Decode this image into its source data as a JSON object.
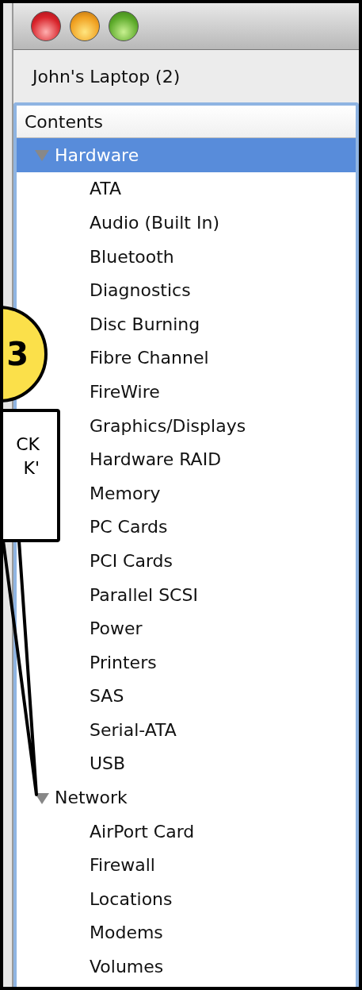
{
  "device": "John's Laptop (2)",
  "outline": {
    "header": "Contents",
    "items": [
      {
        "label": "Hardware",
        "expanded": true,
        "selected": true,
        "children": [
          {
            "label": "ATA",
            "selected": false
          },
          {
            "label": "Audio (Built In)",
            "selected": false
          },
          {
            "label": "Bluetooth",
            "selected": false
          },
          {
            "label": "Diagnostics",
            "selected": false
          },
          {
            "label": "Disc Burning",
            "selected": false
          },
          {
            "label": "Fibre Channel",
            "selected": false
          },
          {
            "label": "FireWire",
            "selected": false
          },
          {
            "label": "Graphics/Displays",
            "selected": false
          },
          {
            "label": "Hardware RAID",
            "selected": false
          },
          {
            "label": "Memory",
            "selected": false
          },
          {
            "label": "PC Cards",
            "selected": false
          },
          {
            "label": "PCI Cards",
            "selected": false
          },
          {
            "label": "Parallel SCSI",
            "selected": false
          },
          {
            "label": "Power",
            "selected": false
          },
          {
            "label": "Printers",
            "selected": false
          },
          {
            "label": "SAS",
            "selected": false
          },
          {
            "label": "Serial-ATA",
            "selected": false
          },
          {
            "label": "USB",
            "selected": false
          }
        ]
      },
      {
        "label": "Network",
        "expanded": true,
        "selected": false,
        "children": [
          {
            "label": "AirPort Card",
            "selected": false
          },
          {
            "label": "Firewall",
            "selected": false
          },
          {
            "label": "Locations",
            "selected": false
          },
          {
            "label": "Modems",
            "selected": false
          },
          {
            "label": "Volumes",
            "selected": false
          }
        ]
      }
    ]
  },
  "annotation": {
    "number": "3",
    "lines": [
      "CK",
      "K'"
    ]
  }
}
